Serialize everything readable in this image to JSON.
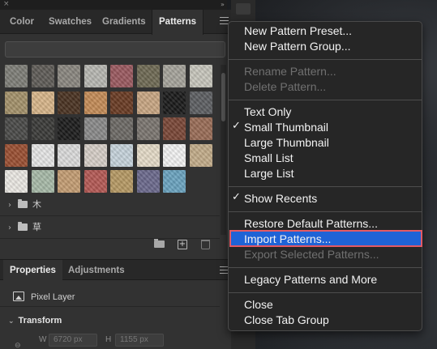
{
  "panel": {
    "tabs": [
      "Color",
      "Swatches",
      "Gradients",
      "Patterns"
    ],
    "active_tab": "Patterns",
    "folders": [
      {
        "label": "木"
      },
      {
        "label": "草"
      }
    ],
    "patterns": [
      [
        "#7e7e78",
        "#5f5c57",
        "#8a8780",
        "#b8b8b2",
        "#9b5a60",
        "#6f6a54",
        "#a6a49c",
        "#c8c7bd"
      ],
      [
        "#a4926b",
        "#d8b68a",
        "#4a3322",
        "#c58c58",
        "#6a3b24",
        "#c9a784",
        "#1a1a1a",
        "#5d5f62"
      ],
      [
        "#4a4a48",
        "#3a3a38",
        "#1c1c1c",
        "#8a8a8a",
        "#6d6a66",
        "#7b7670",
        "#7a4737",
        "#9a6d57"
      ],
      [
        "#9b5033",
        "#e7e7e7",
        "#dcdcdc",
        "#d7cfc8",
        "#c7d4dc",
        "#e6dcc9",
        "#f3f3f3",
        "#c3ad8a"
      ],
      [
        "#ece9e4",
        "#a8bba9",
        "#c59e74",
        "#b55a55",
        "#b79a65",
        "#6c6a8d",
        "#6ba4c0"
      ]
    ],
    "icons": {
      "new_group": "folder-icon",
      "add": "add-icon",
      "delete": "trash-icon"
    }
  },
  "properties_panel": {
    "tabs": [
      "Properties",
      "Adjustments"
    ],
    "active_tab": "Properties",
    "layer_type": "Pixel Layer",
    "section": "Transform",
    "w_label": "W",
    "w_value": "6720 px",
    "h_label": "H",
    "h_value": "1155 px"
  },
  "menu": {
    "groups": [
      [
        {
          "label": "New Pattern Preset...",
          "enabled": true
        },
        {
          "label": "New Pattern Group...",
          "enabled": true
        }
      ],
      [
        {
          "label": "Rename Pattern...",
          "enabled": false
        },
        {
          "label": "Delete Pattern...",
          "enabled": false
        }
      ],
      [
        {
          "label": "Text Only",
          "enabled": true,
          "checked": false
        },
        {
          "label": "Small Thumbnail",
          "enabled": true,
          "checked": true
        },
        {
          "label": "Large Thumbnail",
          "enabled": true,
          "checked": false
        },
        {
          "label": "Small List",
          "enabled": true,
          "checked": false
        },
        {
          "label": "Large List",
          "enabled": true,
          "checked": false
        }
      ],
      [
        {
          "label": "Show Recents",
          "enabled": true,
          "checked": true
        }
      ],
      [
        {
          "label": "Restore Default Patterns...",
          "enabled": true
        },
        {
          "label": "Import Patterns...",
          "enabled": true,
          "highlighted": true
        },
        {
          "label": "Export Selected Patterns...",
          "enabled": false
        }
      ],
      [
        {
          "label": "Legacy Patterns and More",
          "enabled": true
        }
      ],
      [
        {
          "label": "Close",
          "enabled": true
        },
        {
          "label": "Close Tab Group",
          "enabled": true
        }
      ]
    ],
    "check_glyph": "✓",
    "highlight_color": "#1f63d6",
    "highlight_outline": "#e35a65"
  }
}
